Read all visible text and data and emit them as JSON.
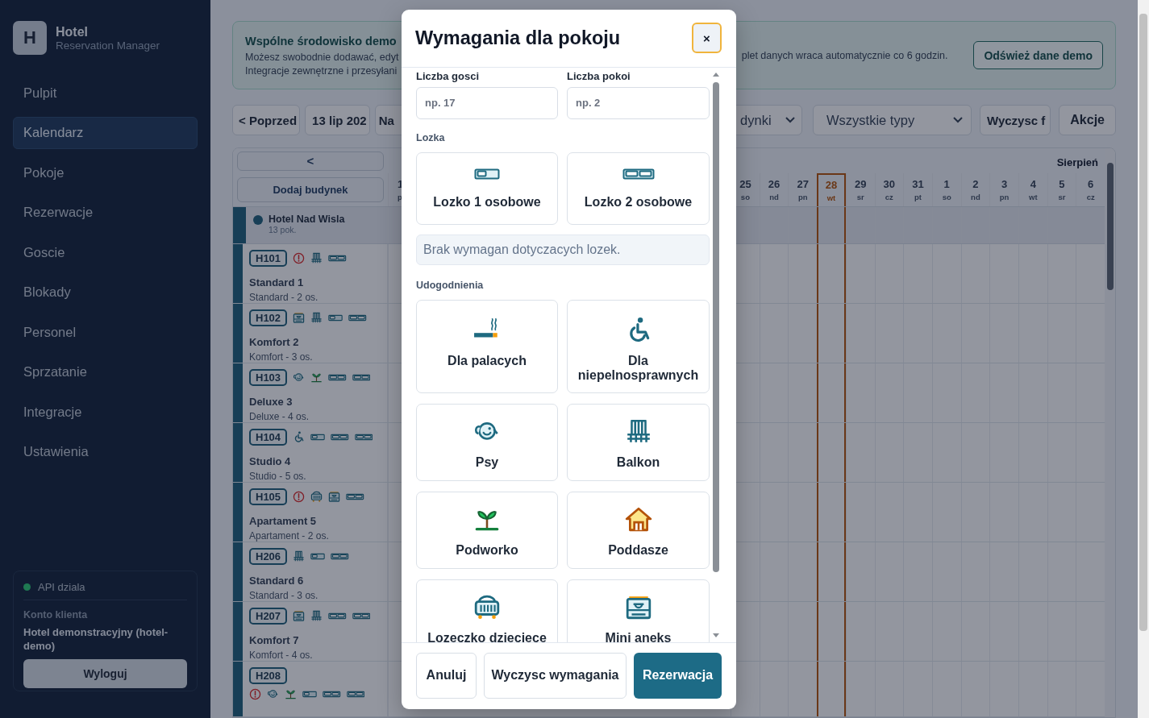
{
  "sidebar": {
    "logo_letter": "H",
    "title": "Hotel",
    "subtitle": "Reservation Manager",
    "nav": [
      {
        "label": "Pulpit",
        "selected": false
      },
      {
        "label": "Kalendarz",
        "selected": true
      },
      {
        "label": "Pokoje",
        "selected": false
      },
      {
        "label": "Rezerwacje",
        "selected": false
      },
      {
        "label": "Goscie",
        "selected": false
      },
      {
        "label": "Blokady",
        "selected": false
      },
      {
        "label": "Personel",
        "selected": false
      },
      {
        "label": "Sprzatanie",
        "selected": false
      },
      {
        "label": "Integracje",
        "selected": false
      },
      {
        "label": "Ustawienia",
        "selected": false
      }
    ],
    "status": {
      "text": "API dziala",
      "color": "#1f7a52"
    },
    "account": {
      "label": "Konto klienta",
      "name": "Hotel demonstracyjny (hotel-demo)",
      "button": "Wyloguj"
    }
  },
  "banner": {
    "title": "Wspólne środowisko demo",
    "lines": [
      "Możesz swobodnie dodawać, edyt",
      "Integracje zewnętrzne i przesyłani"
    ],
    "right_text": "plet danych wraca automatycznie co 6 godzin.",
    "button": "Odśwież dane demo"
  },
  "toolbar": {
    "left_buttons": [
      "< Poprzed",
      "13 lip 202",
      "Na"
    ],
    "selects": [
      "dynki",
      "Wszystkie typy"
    ],
    "right_buttons": [
      "Wyczysc f",
      "Akcje"
    ]
  },
  "calendar": {
    "back_button": "<",
    "add_building_button": "Dodaj budynek",
    "month": "Sierpień",
    "first_day": {
      "day": "1",
      "weekday": "p"
    },
    "days": [
      {
        "day": "25",
        "weekday": "so",
        "today": false
      },
      {
        "day": "26",
        "weekday": "nd",
        "today": false
      },
      {
        "day": "27",
        "weekday": "pn",
        "today": false
      },
      {
        "day": "28",
        "weekday": "wt",
        "today": true
      },
      {
        "day": "29",
        "weekday": "sr",
        "today": false
      },
      {
        "day": "30",
        "weekday": "cz",
        "today": false
      },
      {
        "day": "31",
        "weekday": "pt",
        "today": false
      },
      {
        "day": "1",
        "weekday": "so",
        "today": false
      },
      {
        "day": "2",
        "weekday": "nd",
        "today": false
      },
      {
        "day": "3",
        "weekday": "pn",
        "today": false
      },
      {
        "day": "4",
        "weekday": "wt",
        "today": false
      },
      {
        "day": "5",
        "weekday": "sr",
        "today": false
      },
      {
        "day": "6",
        "weekday": "cz",
        "today": false
      }
    ],
    "building": {
      "name": "Hotel Nad Wisla",
      "rooms_count": "13 pok.",
      "color": "#173f56"
    },
    "rooms": [
      {
        "code": "H101",
        "name": "Standard 1",
        "type": "Standard - 2 os.",
        "features": [
          {
            "kind": "alert"
          },
          {
            "kind": "balcony"
          },
          {
            "kind": "bed2"
          }
        ]
      },
      {
        "code": "H102",
        "name": "Komfort 2",
        "type": "Komfort - 3 os.",
        "features": [
          {
            "kind": "kitchen"
          },
          {
            "kind": "balcony"
          },
          {
            "kind": "bed1"
          },
          {
            "kind": "bed2"
          }
        ]
      },
      {
        "code": "H103",
        "name": "Deluxe 3",
        "type": "Deluxe - 4 os.",
        "features": [
          {
            "kind": "dog"
          },
          {
            "kind": "garden"
          },
          {
            "kind": "bed2"
          },
          {
            "kind": "bed2"
          }
        ]
      },
      {
        "code": "H104",
        "name": "Studio 4",
        "type": "Studio - 5 os.",
        "features": [
          {
            "kind": "wheelchair"
          },
          {
            "kind": "bed1"
          },
          {
            "kind": "bed2"
          },
          {
            "kind": "bed2"
          }
        ]
      },
      {
        "code": "H105",
        "name": "Apartament 5",
        "type": "Apartament - 2 os.",
        "features": [
          {
            "kind": "alert"
          },
          {
            "kind": "crib"
          },
          {
            "kind": "kitchen"
          },
          {
            "kind": "bed2"
          }
        ]
      },
      {
        "code": "H206",
        "name": "Standard 6",
        "type": "Standard - 3 os.",
        "features": [
          {
            "kind": "balcony"
          },
          {
            "kind": "bed1"
          },
          {
            "kind": "bed2"
          }
        ]
      },
      {
        "code": "H207",
        "name": "Komfort 7",
        "type": "Komfort - 4 os.",
        "features": [
          {
            "kind": "kitchen"
          },
          {
            "kind": "balcony"
          },
          {
            "kind": "bed2"
          },
          {
            "kind": "bed2"
          }
        ]
      },
      {
        "code": "H208",
        "features": [
          {
            "kind": "alert"
          },
          {
            "kind": "dog"
          },
          {
            "kind": "garden"
          },
          {
            "kind": "bed1"
          },
          {
            "kind": "bed2"
          },
          {
            "kind": "bed2"
          }
        ]
      }
    ]
  },
  "modal": {
    "title": "Wymagania dla pokoju",
    "close": "×",
    "fields": [
      {
        "label": "Liczba gosci",
        "placeholder": "np. 17"
      },
      {
        "label": "Liczba pokoi",
        "placeholder": "np. 2"
      }
    ],
    "beds_label": "Lozka",
    "beds": [
      {
        "label": "Lozko 1 osobowe",
        "kind": "bed1",
        "selected": false
      },
      {
        "label": "Lozko 2 osobowe",
        "kind": "bed2",
        "selected": false
      }
    ],
    "beds_note": "Brak wymagan dotyczacych lozek.",
    "amenities_label": "Udogodnienia",
    "amenities": [
      {
        "label": "Dla palacych",
        "kind": "smoking",
        "selected": false
      },
      {
        "label": "Dla niepelnosprawnych",
        "kind": "wheelchair",
        "selected": false
      },
      {
        "label": "Psy",
        "kind": "dog",
        "selected": false
      },
      {
        "label": "Balkon",
        "kind": "balcony",
        "selected": false
      },
      {
        "label": "Podworko",
        "kind": "garden",
        "selected": false
      },
      {
        "label": "Poddasze",
        "kind": "attic",
        "selected": false
      },
      {
        "label": "Lozeczko dzieciece",
        "kind": "crib",
        "selected": false
      },
      {
        "label": "Mini aneks",
        "kind": "kitchen",
        "selected": false
      }
    ],
    "buttons": [
      {
        "label": "Anuluj",
        "kind": "secondary"
      },
      {
        "label": "Wyczysc wymagania",
        "kind": "secondary"
      },
      {
        "label": "Rezerwacja",
        "kind": "primary"
      }
    ]
  }
}
